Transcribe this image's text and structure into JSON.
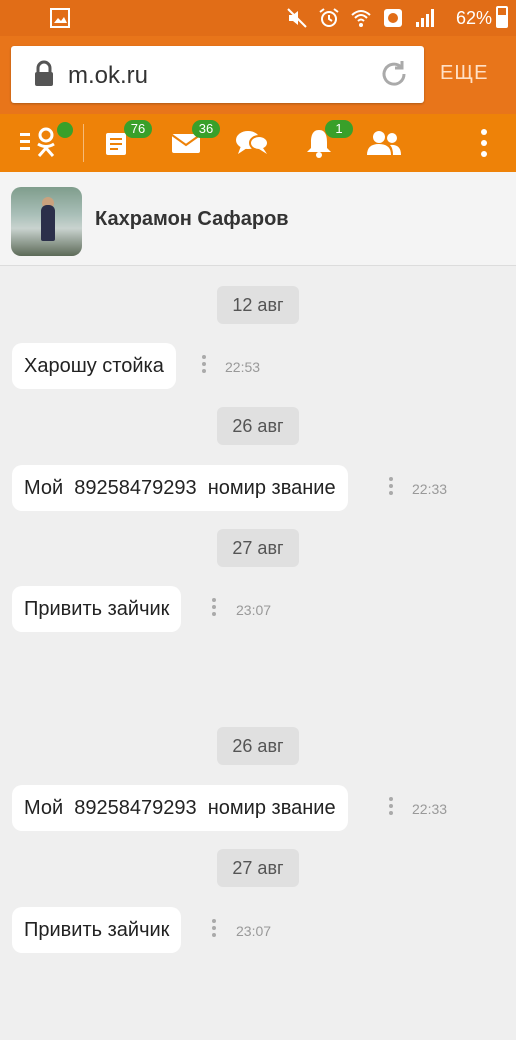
{
  "status_bar": {
    "battery_percent": "62%",
    "colors": {
      "background": "#e16d17"
    }
  },
  "browser": {
    "url": "m.ok.ru",
    "more_label": "ЕЩЕ",
    "icons": [
      "lock-icon",
      "reload-icon"
    ]
  },
  "nav": {
    "items": [
      {
        "name": "ok-logo-menu",
        "icon": "ok-logo-icon"
      },
      {
        "name": "feed",
        "icon": "feed-icon",
        "badge": "76"
      },
      {
        "name": "messages",
        "icon": "envelope-icon",
        "badge": "36"
      },
      {
        "name": "discussions",
        "icon": "chat-bubbles-icon"
      },
      {
        "name": "notifications",
        "icon": "bell-icon",
        "badge": "1"
      },
      {
        "name": "friends",
        "icon": "people-icon"
      },
      {
        "name": "overflow",
        "icon": "more-vertical-icon"
      }
    ],
    "colors": {
      "background": "#ee8208",
      "badge": "#39a02a"
    }
  },
  "chat": {
    "contact_name": "Кахрамон Сафаров",
    "dates": [
      "12 авг",
      "26 авг",
      "27 авг",
      "26 авг",
      "27 авг"
    ],
    "messages": [
      {
        "text": "Харошу стойка",
        "time": "22:53"
      },
      {
        "text": "Мой  89258479293  номир звание",
        "time": "22:33"
      },
      {
        "text": "Привить зайчик",
        "time": "23:07"
      },
      {
        "text": "Мой  89258479293  номир звание",
        "time": "22:33"
      },
      {
        "text": "Привить зайчик",
        "time": "23:07"
      }
    ]
  }
}
